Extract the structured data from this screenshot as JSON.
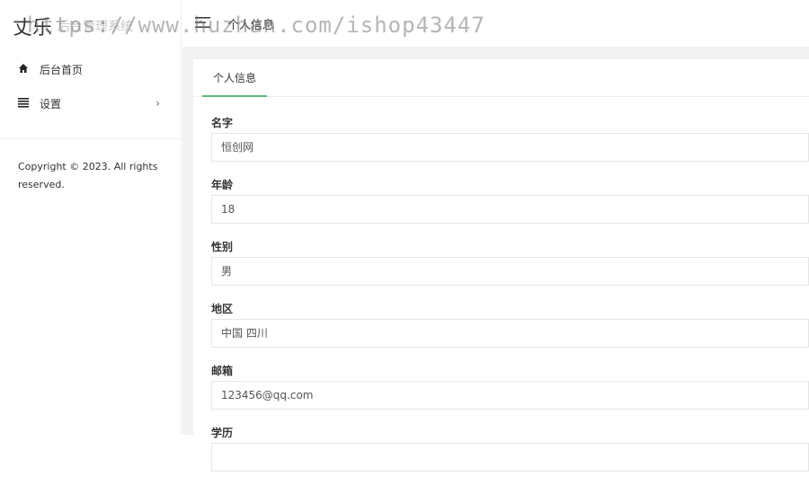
{
  "app": {
    "logo_glyph": "丈乐",
    "title": "后台管理系统"
  },
  "sidebar": {
    "items": [
      {
        "label": "后台首页",
        "icon": "home-icon"
      },
      {
        "label": "设置",
        "icon": "list-icon",
        "arrow": "›"
      }
    ],
    "copyright": "Copyright © 2023. All rights reserved."
  },
  "topbar": {
    "menu_icon": "hamburger-menu-icon",
    "heading": "个人信息"
  },
  "tabs": [
    {
      "label": "个人信息",
      "active": true
    }
  ],
  "form": {
    "fields": [
      {
        "label": "名字",
        "value": "恒创网"
      },
      {
        "label": "年龄",
        "value": "18"
      },
      {
        "label": "性别",
        "value": "男"
      },
      {
        "label": "地区",
        "value": "中国 四川"
      },
      {
        "label": "邮箱",
        "value": "123456@qq.com"
      },
      {
        "label": "学历",
        "value": ""
      }
    ]
  },
  "watermark": "https://www.huzhan.com/ishop43447",
  "colors": {
    "accent": "#5fb878",
    "content_bg": "#f2f2f2"
  }
}
